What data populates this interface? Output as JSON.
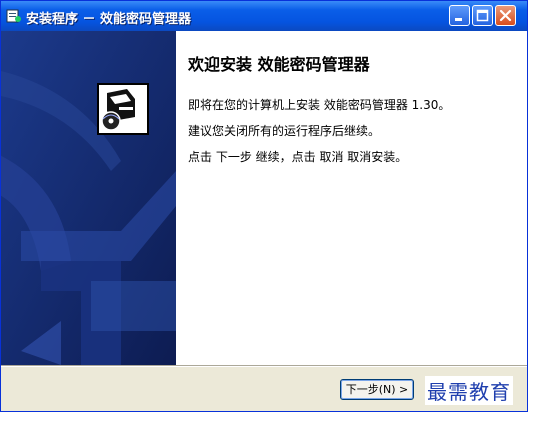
{
  "window": {
    "title": "安装程序 － 效能密码管理器"
  },
  "content": {
    "heading": "欢迎安装 效能密码管理器",
    "paragraphs": [
      "即将在您的计算机上安装 效能密码管理器 1.30。",
      "建议您关闭所有的运行程序后继续。",
      "点击 下一步 继续，点击 取消 取消安装。"
    ]
  },
  "buttons": {
    "next_label": "下一步(N) >"
  },
  "watermark": {
    "text": "最需教育"
  },
  "colors": {
    "titlebar": "#0554e0",
    "sidebar": "#162a6a",
    "dialog_bg": "#ece9d8"
  },
  "icons": {
    "app": "installer-icon",
    "product": "computer-disc-icon",
    "minimize": "minimize-icon",
    "maximize": "maximize-icon",
    "close": "close-icon"
  }
}
